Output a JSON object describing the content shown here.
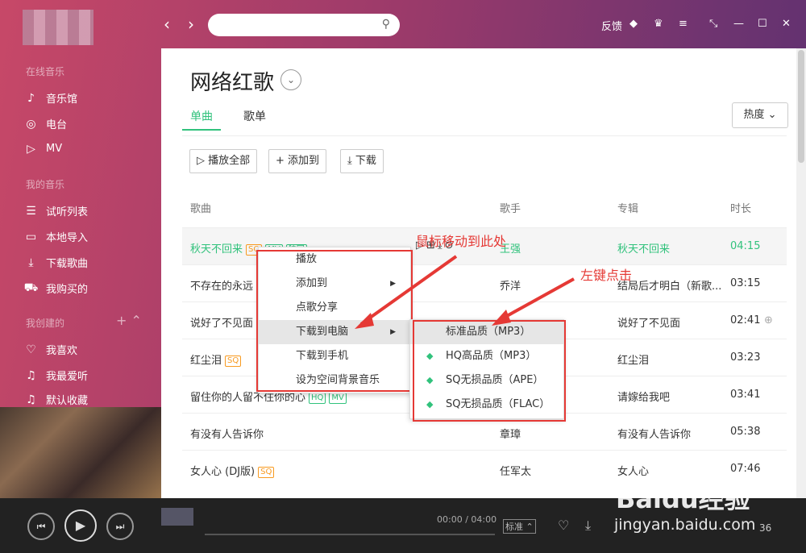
{
  "topbar": {
    "feedback": "反馈"
  },
  "sidebar": {
    "sections": {
      "online": "在线音乐",
      "mine": "我的音乐",
      "created": "我创建的"
    },
    "items": [
      {
        "label": "音乐馆",
        "icon": "music-hall-icon"
      },
      {
        "label": "电台",
        "icon": "radio-icon"
      },
      {
        "label": "MV",
        "icon": "mv-icon"
      },
      {
        "label": "试听列表",
        "icon": "playlist-icon"
      },
      {
        "label": "本地导入",
        "icon": "monitor-icon"
      },
      {
        "label": "下载歌曲",
        "icon": "download-icon"
      },
      {
        "label": "我购买的",
        "icon": "cart-icon"
      },
      {
        "label": "我喜欢",
        "icon": "heart-icon"
      },
      {
        "label": "我最爱听",
        "icon": "note-icon"
      },
      {
        "label": "默认收藏",
        "icon": "note-icon"
      }
    ]
  },
  "page": {
    "title": "网络红歌",
    "tabs": [
      "单曲",
      "歌单"
    ],
    "sort": "热度",
    "actions": {
      "play_all": "播放全部",
      "add_to": "添加到",
      "download": "下载"
    },
    "headers": {
      "song": "歌曲",
      "singer": "歌手",
      "album": "专辑",
      "duration": "时长"
    }
  },
  "songs": [
    {
      "title": "秋天不回来",
      "singer": "王强",
      "album": "秋天不回来",
      "duration": "04:15"
    },
    {
      "title": "不存在的永远",
      "singer": "乔洋",
      "album": "结局后才明白（新歌...",
      "duration": "03:15"
    },
    {
      "title": "说好了不见面",
      "singer": "",
      "album": "说好了不见面",
      "duration": "02:41"
    },
    {
      "title": "红尘泪",
      "singer": "",
      "album": "红尘泪",
      "duration": "03:23"
    },
    {
      "title": "留住你的人留不住你的心",
      "singer": "",
      "album": "请嫁给我吧",
      "duration": "03:41"
    },
    {
      "title": "有没有人告诉你",
      "singer": "章璋",
      "album": "有没有人告诉你",
      "duration": "05:38"
    },
    {
      "title": "女人心 (DJ版)",
      "singer": "任军太",
      "album": "女人心",
      "duration": "07:46"
    }
  ],
  "badges": {
    "sq": "SQ",
    "mv": "MV",
    "exclusive": "独家",
    "hq": "HQ"
  },
  "context_menu": [
    "播放",
    "添加到",
    "点歌分享",
    "下载到电脑",
    "下载到手机",
    "设为空间背景音乐"
  ],
  "submenu": [
    "标准品质（MP3）",
    "HQ高品质（MP3）",
    "SQ无损品质（APE）",
    "SQ无损品质（FLAC）"
  ],
  "annotations": {
    "hover": "鼠标移动到此处",
    "click": "左键点击"
  },
  "player": {
    "time": "00:00 / 04:00",
    "quality": "标准",
    "count": "36"
  },
  "watermark": {
    "brand": "Baidu经验",
    "url": "jingyan.baidu.com"
  }
}
